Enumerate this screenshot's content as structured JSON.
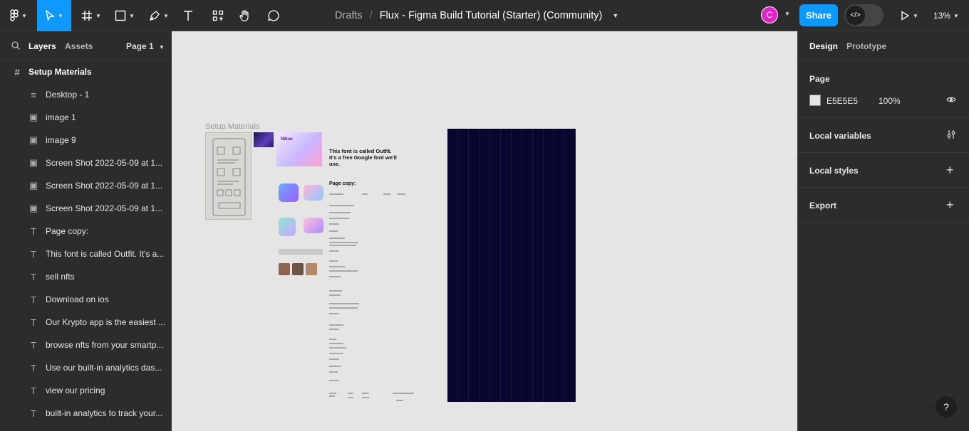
{
  "toolbar": {
    "breadcrumb_root": "Drafts",
    "breadcrumb_sep": "/",
    "file_name": "Flux - Figma Build Tutorial (Starter) (Community)",
    "avatar_initial": "C",
    "share_label": "Share",
    "zoom": "13%",
    "tools": [
      "figma-menu-icon",
      "move-tool-icon",
      "frame-tool-icon",
      "shape-tool-icon",
      "pen-tool-icon",
      "text-tool-icon",
      "actions-icon",
      "hand-tool-icon",
      "comment-icon"
    ]
  },
  "left_panel": {
    "tab_layers": "Layers",
    "tab_assets": "Assets",
    "page_selector": "Page 1",
    "layers": [
      {
        "name": "Setup Materials",
        "type": "frame"
      },
      {
        "name": "Desktop - 1",
        "type": "section"
      },
      {
        "name": "image 1",
        "type": "image"
      },
      {
        "name": "image 9",
        "type": "image"
      },
      {
        "name": "Screen Shot 2022-05-09 at 1...",
        "type": "image"
      },
      {
        "name": "Screen Shot 2022-05-09 at 1...",
        "type": "image"
      },
      {
        "name": "Screen Shot 2022-05-09 at 1...",
        "type": "image"
      },
      {
        "name": "Page copy:",
        "type": "text"
      },
      {
        "name": "This font is called Outfit. It's a...",
        "type": "text"
      },
      {
        "name": "sell nfts",
        "type": "text"
      },
      {
        "name": "Download on ios",
        "type": "text"
      },
      {
        "name": "Our Krypto app is the easiest ...",
        "type": "text"
      },
      {
        "name": "browse nfts from your smartp...",
        "type": "text"
      },
      {
        "name": "Use our built-in analytics das...",
        "type": "text"
      },
      {
        "name": "view our pricing",
        "type": "text"
      },
      {
        "name": "built-in analytics to track your...",
        "type": "text"
      }
    ]
  },
  "canvas": {
    "frame_label": "Setup Materials",
    "nikuu_label": "Nikuu",
    "doc_title": "This font is called Outfit. It's a free Google font we'll use.",
    "doc_subtitle": "Page copy:",
    "background": "#e5e5e5",
    "dark_frame_color": "#07062e"
  },
  "right_panel": {
    "tab_design": "Design",
    "tab_prototype": "Prototype",
    "page_title": "Page",
    "page_color": "E5E5E5",
    "page_opacity": "100%",
    "local_variables": "Local variables",
    "local_styles": "Local styles",
    "export": "Export"
  },
  "help": "?",
  "colors": {
    "accent": "#0d99ff",
    "avatar": "#e521c9",
    "panel": "#2c2c2c"
  }
}
